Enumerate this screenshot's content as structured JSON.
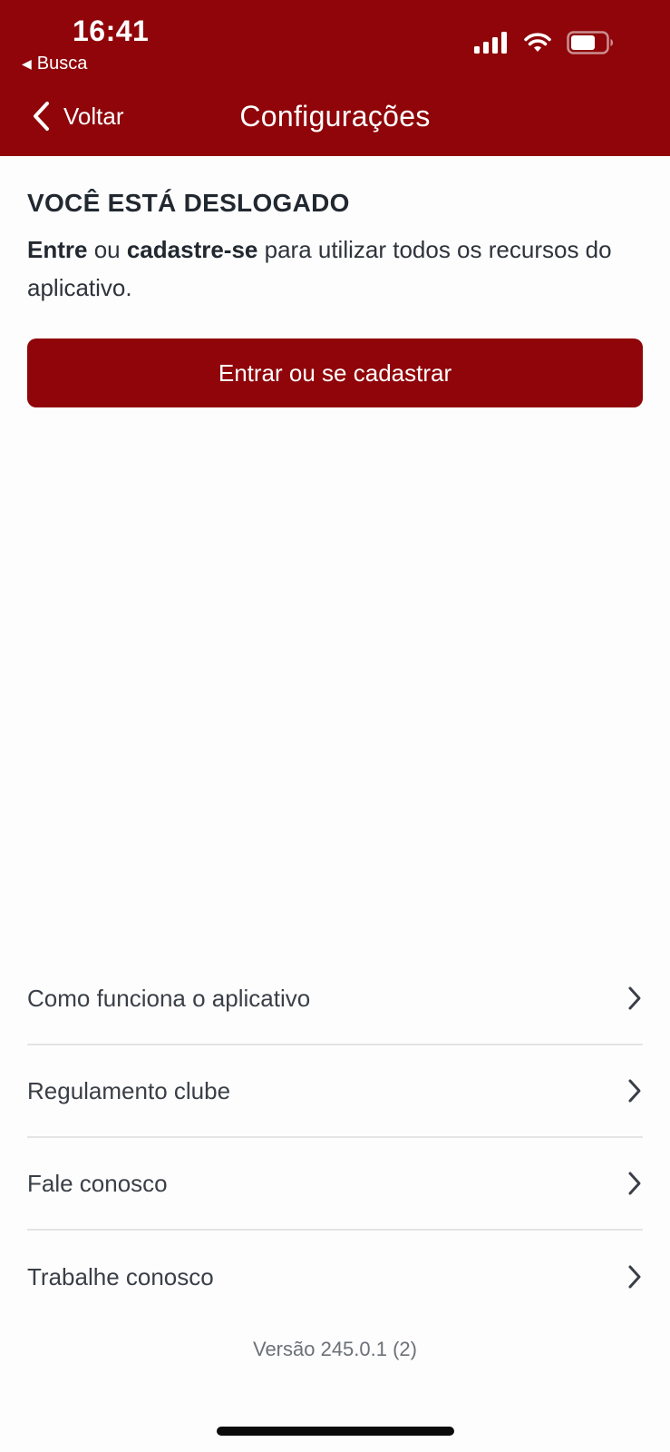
{
  "status_bar": {
    "time": "16:41",
    "back_app": "Busca",
    "icons": [
      "signal-icon",
      "wifi-icon",
      "battery-icon"
    ]
  },
  "nav": {
    "back_label": "Voltar",
    "title": "Configurações"
  },
  "logged_out": {
    "heading": "VOCÊ ESTÁ DESLOGADO",
    "desc_bold1": "Entre",
    "desc_text1": " ou ",
    "desc_bold2": "cadastre-se",
    "desc_text2": " para utilizar todos os recursos do aplicativo.",
    "button_label": "Entrar ou se cadastrar"
  },
  "menu": {
    "items": [
      {
        "label": "Como funciona o aplicativo"
      },
      {
        "label": "Regulamento clube"
      },
      {
        "label": "Fale conosco"
      },
      {
        "label": "Trabalhe conosco"
      }
    ]
  },
  "version": "Versão 245.0.1 (2)",
  "colors": {
    "brand": "#8f0509",
    "background": "#fdfdfd",
    "divider": "#e4e4e6"
  }
}
